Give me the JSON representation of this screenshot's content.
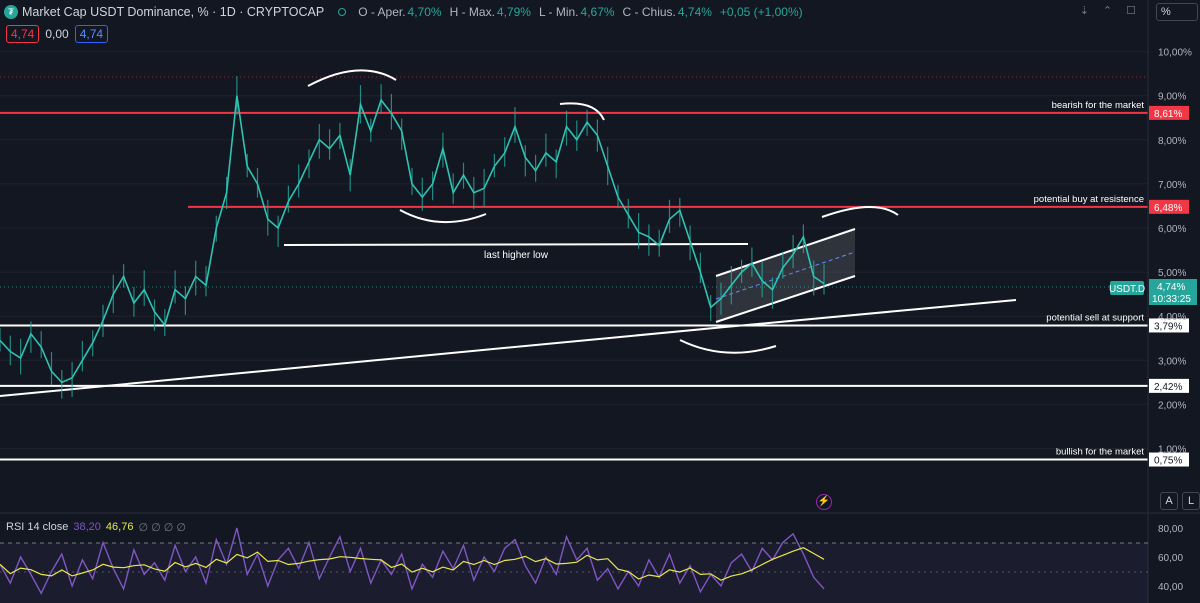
{
  "header": {
    "title": "Market Cap USDT Dominance, % · 1D · CRYPTOCAP",
    "ohlc": [
      {
        "label": "O - Aper.",
        "value": "4,70%"
      },
      {
        "label": "H - Max.",
        "value": "4,79%"
      },
      {
        "label": "L - Min.",
        "value": "4,67%"
      },
      {
        "label": "C - Chius.",
        "value": "4,74%"
      }
    ],
    "change": "+0,05 (+1,00%)",
    "box1": "4,74",
    "box2": "0,00",
    "box3": "4,74",
    "scale_button": "%"
  },
  "chart_data": {
    "type": "line",
    "title": "Market Cap USDT Dominance, % · 1D · CRYPTOCAP",
    "ylim": [
      0.5,
      10.6
    ],
    "y_ticks": [
      "10,00%",
      "9,00%",
      "8,00%",
      "7,00%",
      "6,00%",
      "5,00%",
      "4,00%",
      "3,00%",
      "2,00%",
      "1,00%"
    ],
    "y_tick_values": [
      10,
      9,
      8,
      7,
      6,
      5,
      4,
      3,
      2,
      1
    ],
    "series": [
      {
        "values": [
          3.45,
          3.2,
          3.05,
          3.6,
          3.3,
          2.75,
          2.5,
          2.6,
          3.0,
          3.4,
          3.9,
          4.5,
          4.9,
          4.3,
          4.6,
          4.1,
          3.8,
          4.6,
          4.4,
          4.9,
          4.7,
          6.0,
          6.8,
          9.0,
          7.4,
          7.0,
          6.2,
          6.0,
          6.6,
          7.0,
          7.5,
          8.0,
          7.8,
          8.1,
          7.2,
          8.8,
          8.2,
          8.9,
          8.6,
          8.2,
          7.0,
          6.7,
          7.0,
          7.8,
          6.8,
          7.2,
          6.8,
          6.9,
          7.4,
          7.7,
          8.3,
          7.6,
          7.3,
          7.7,
          7.5,
          8.3,
          8.0,
          8.4,
          8.1,
          7.4,
          6.7,
          6.3,
          5.9,
          5.8,
          5.6,
          6.2,
          6.4,
          5.7,
          5.0,
          4.2,
          4.4,
          4.7,
          5.0,
          5.2,
          4.8,
          4.6,
          5.1,
          5.4,
          5.8,
          4.9,
          4.74
        ]
      }
    ],
    "last_value_label": "4,74%",
    "symbol": "USDT.D",
    "countdown": "10:33:25",
    "levels": [
      {
        "label": "bearish for the market",
        "price": "8,61%",
        "value": 8.61,
        "color": "#f23645"
      },
      {
        "label": "potential buy at resistence",
        "price": "6,48%",
        "value": 6.48,
        "color": "#f23645"
      },
      {
        "label": "potential sell at support",
        "price": "3,79%",
        "value": 3.79,
        "color": "#ffffff"
      },
      {
        "label": "",
        "price": "2,42%",
        "value": 2.42,
        "color": "#ffffff"
      },
      {
        "label": "bullish for the market",
        "price": "0,75%",
        "value": 0.75,
        "color": "#ffffff"
      }
    ],
    "annotation": "last higher low"
  },
  "rsi": {
    "label": "RSI 14 close",
    "value1": "38,20",
    "value2": "46,76",
    "dots": "∅ ∅ ∅ ∅",
    "ylim": [
      30,
      85
    ],
    "y_ticks": [
      "80,00",
      "60,00",
      "40,00"
    ],
    "y_tick_values": [
      80,
      60,
      40
    ],
    "values": [
      55,
      42,
      60,
      48,
      35,
      50,
      62,
      40,
      58,
      45,
      70,
      52,
      38,
      65,
      48,
      56,
      44,
      68,
      50,
      60,
      42,
      72,
      55,
      80,
      48,
      62,
      40,
      58,
      66,
      52,
      70,
      45,
      60,
      74,
      50,
      66,
      42,
      58,
      48,
      62,
      38,
      55,
      46,
      64,
      52,
      68,
      44,
      60,
      50,
      66,
      72,
      54,
      42,
      60,
      48,
      74,
      58,
      66,
      44,
      52,
      38,
      50,
      40,
      58,
      46,
      62,
      42,
      54,
      36,
      48,
      40,
      56,
      62,
      50,
      66,
      58,
      70,
      76,
      62,
      46,
      38
    ]
  },
  "bottom_buttons": {
    "auto": "A",
    "log": "L"
  }
}
